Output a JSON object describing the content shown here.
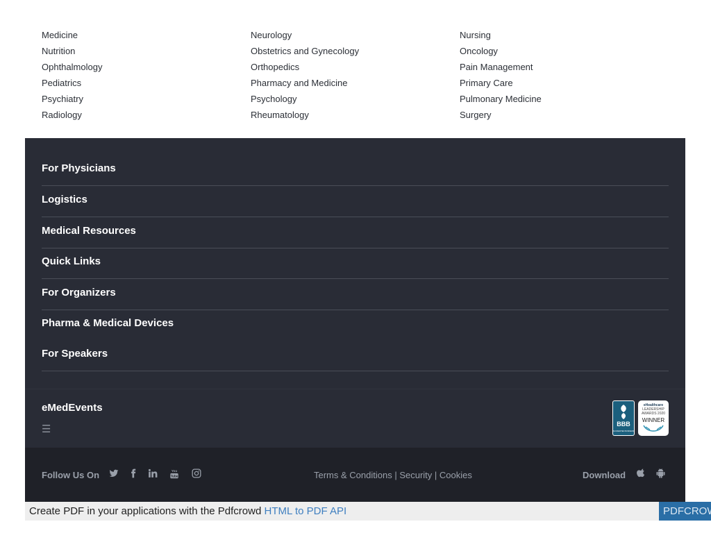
{
  "specialties": [
    "Medicine",
    "Neurology",
    "Nursing",
    "Nutrition",
    "Obstetrics and Gynecology",
    "Oncology",
    "Ophthalmology",
    "Orthopedics",
    "Pain Management",
    "Pediatrics",
    "Pharmacy and Medicine",
    "Primary Care",
    "Psychiatry",
    "Psychology",
    "Pulmonary Medicine",
    "Radiology",
    "Rheumatology",
    "Surgery"
  ],
  "footer": {
    "sections": [
      "For Physicians",
      "Logistics",
      "Medical Resources",
      "Quick Links",
      "For Organizers",
      "Pharma & Medical Devices",
      "For Speakers"
    ],
    "brand": "eMedEvents",
    "menu_icon": "☰",
    "badges": {
      "bbb_top": "BBB",
      "bbb_bottom": "ACCREDITED BUSINESS",
      "award_line1": "eHealthcare",
      "award_line2": "LEADERSHIP",
      "award_line3": "AWARDS 2020",
      "award_line4": "WINNER"
    },
    "follow_label": "Follow Us On",
    "social_icons": [
      "twitter-icon",
      "facebook-icon",
      "linkedin-icon",
      "youtube-icon",
      "instagram-icon"
    ],
    "legal": {
      "terms": "Terms & Conditions",
      "sep1": " | ",
      "security": "Security",
      "sep2": " | ",
      "cookies": "Cookies"
    },
    "download_label": "Download"
  },
  "pdfcrowd": {
    "text": "Create PDF in your applications with the Pdfcrowd ",
    "link": "HTML to PDF API",
    "logo": "PDFCROWD"
  },
  "colors": {
    "footer_bg": "#292c36",
    "bottom_bg": "#1f2128",
    "link_blue": "#3f7fc0"
  }
}
